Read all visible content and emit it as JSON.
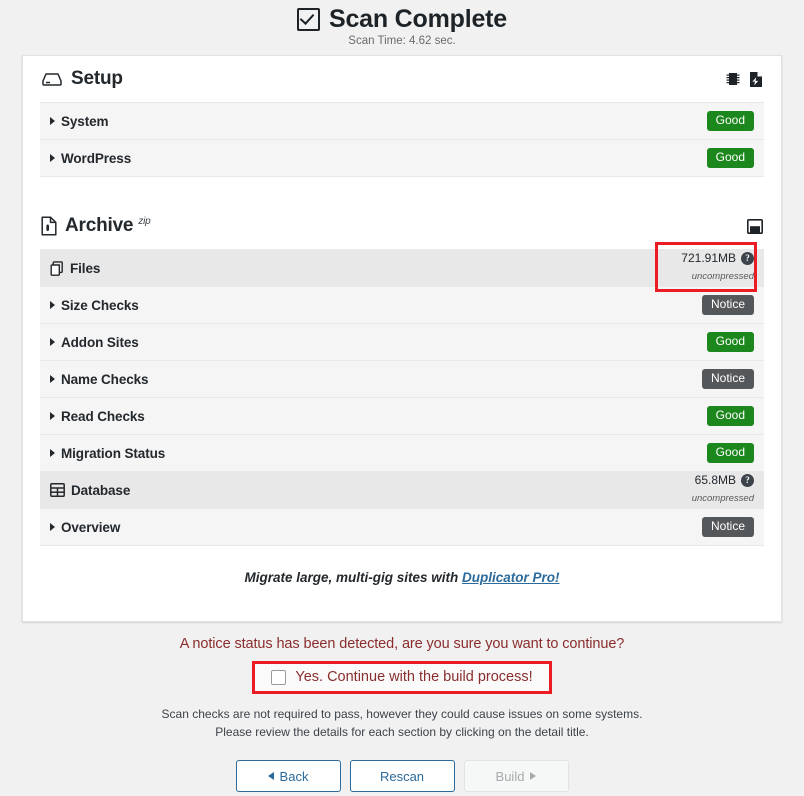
{
  "header": {
    "title": "Scan Complete",
    "check_icon": "checkbox-checked-icon",
    "scan_time": "Scan Time: 4.62 sec."
  },
  "setup": {
    "title": "Setup",
    "icon": "server-icon",
    "actions": [
      {
        "name": "memory-chip-icon",
        "label": ""
      },
      {
        "name": "file-power-icon",
        "label": ""
      }
    ],
    "rows": [
      {
        "label": "System",
        "status": "Good",
        "status_type": "good"
      },
      {
        "label": "WordPress",
        "status": "Good",
        "status_type": "good"
      }
    ]
  },
  "archive": {
    "title": "Archive",
    "superscript": "zip",
    "icon": "file-zip-icon",
    "action_icon": "archive-box-icon",
    "files": {
      "label": "Files",
      "icon": "copy-files-icon",
      "size": "721.91MB",
      "size_note": "uncompressed",
      "help_icon": "question-mark-icon"
    },
    "rows": [
      {
        "label": "Size Checks",
        "status": "Notice",
        "status_type": "notice"
      },
      {
        "label": "Addon Sites",
        "status": "Good",
        "status_type": "good"
      },
      {
        "label": "Name Checks",
        "status": "Notice",
        "status_type": "notice"
      },
      {
        "label": "Read Checks",
        "status": "Good",
        "status_type": "good"
      },
      {
        "label": "Migration Status",
        "status": "Good",
        "status_type": "good"
      }
    ]
  },
  "database": {
    "label": "Database",
    "icon": "table-grid-icon",
    "size": "65.8MB",
    "size_note": "uncompressed",
    "help_icon": "question-mark-icon",
    "rows": [
      {
        "label": "Overview",
        "status": "Notice",
        "status_type": "notice"
      }
    ]
  },
  "promo": {
    "text": "Migrate large, multi-gig sites with ",
    "link": "Duplicator Pro!"
  },
  "bottom": {
    "notice_question": "A notice status has been detected, are you sure you want to continue?",
    "confirm_label": "Yes. Continue with the build process!",
    "confirm_checked": false,
    "sub_note_line1": "Scan checks are not required to pass, however they could cause issues on some systems.",
    "sub_note_line2": "Please review the details for each section by clicking on the detail title.",
    "buttons": [
      {
        "name": "back-button",
        "label": "Back",
        "icon": "arrow-left-icon",
        "disabled": false
      },
      {
        "name": "rescan-button",
        "label": "Rescan",
        "icon": "",
        "disabled": false
      },
      {
        "name": "build-button",
        "label": "Build",
        "icon": "arrow-right-icon",
        "disabled": true
      }
    ]
  },
  "colors": {
    "good": "#1c871c",
    "notice": "#55585b",
    "highlight": "#ec1c24",
    "link": "#2b6a9b",
    "warning_text": "#8a2d2d"
  }
}
